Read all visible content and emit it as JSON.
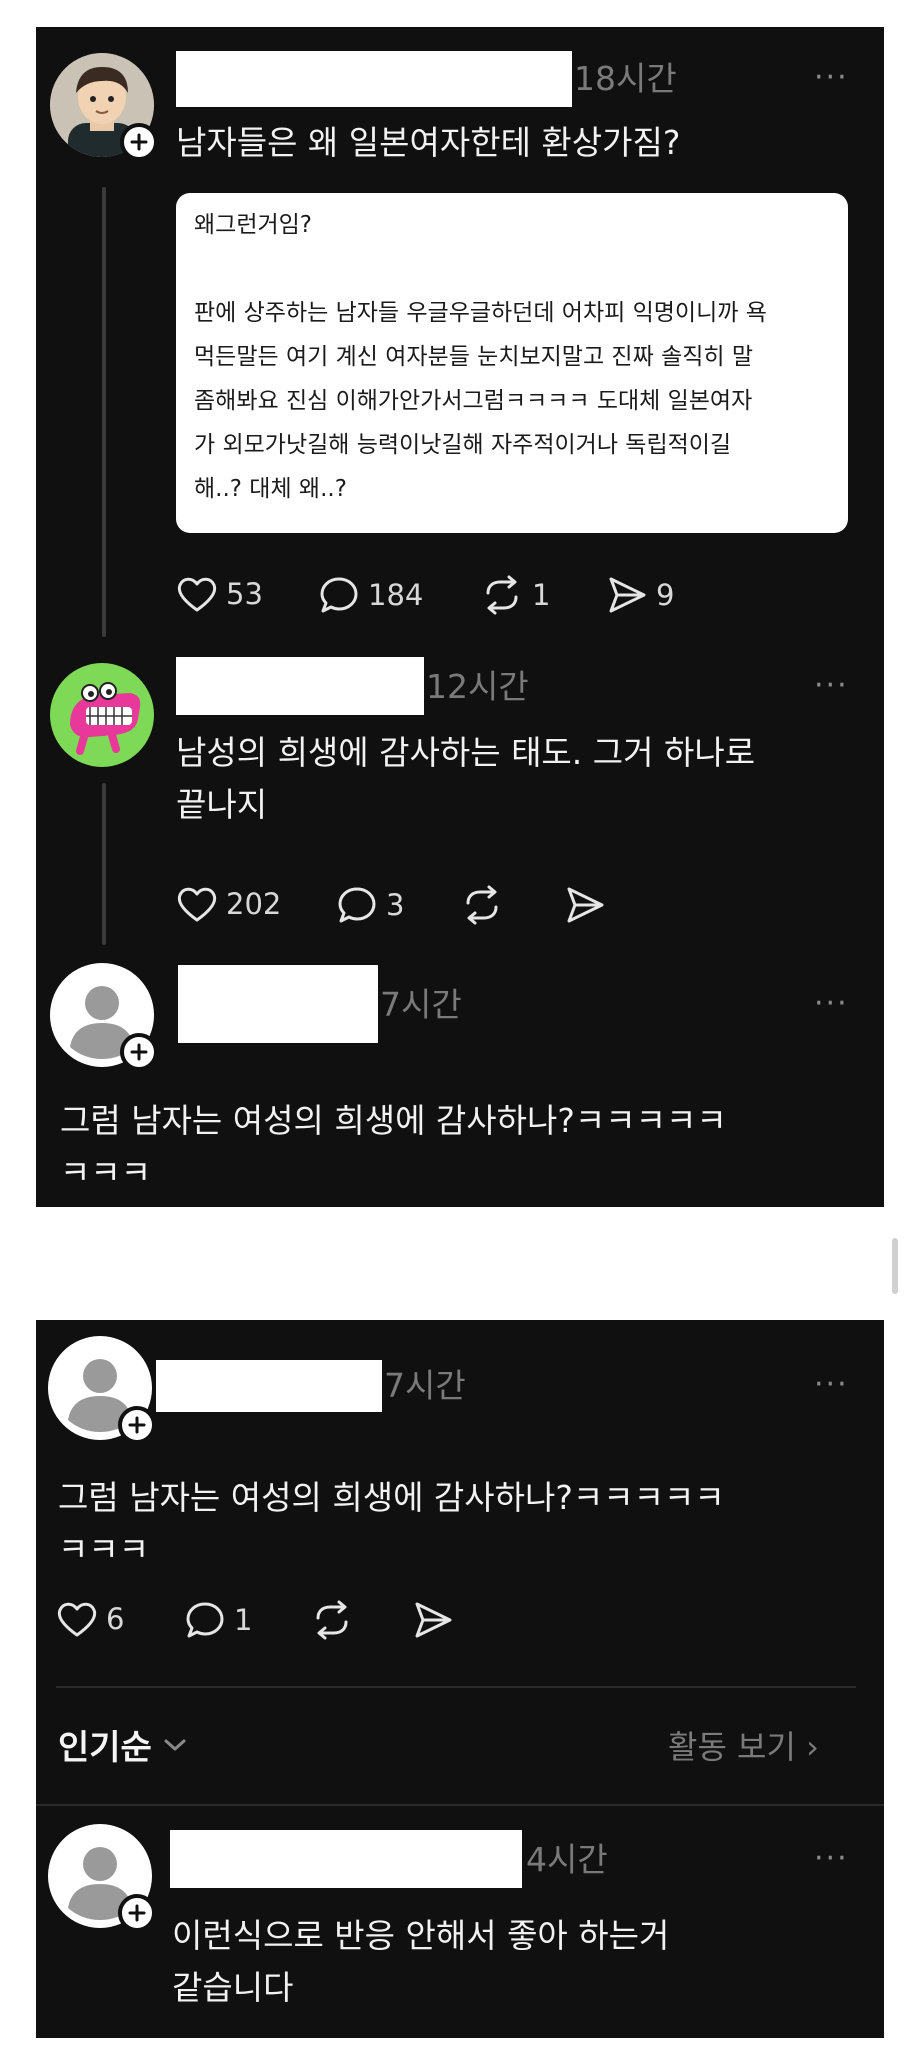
{
  "panel1": {
    "post": {
      "time": "18시간",
      "text": "남자들은 왜 일본여자한테 환상가짐?",
      "quote_lines": [
        "왜그런거임?",
        "",
        "판에 상주하는 남자들 우글우글하던데 어차피 익명이니까 욕",
        "먹든말든 여기 계신 여자분들 눈치보지말고 진짜 솔직히 말",
        "좀해봐요 진심 이해가안가서그럼ㅋㅋㅋㅋ 도대체 일본여자",
        "가 외모가낫길해 능력이낫길해 자주적이거나 독립적이길",
        "해..? 대체 왜..?"
      ],
      "likes": "53",
      "comments": "184",
      "reposts": "1",
      "shares": "9"
    },
    "reply1": {
      "time": "12시간",
      "text_lines": [
        "남성의 희생에 감사하는 태도. 그거 하나로",
        "끝나지"
      ],
      "likes": "202",
      "comments": "3"
    },
    "reply2": {
      "time": "7시간",
      "text_lines": [
        "그럼 남자는 여성의 희생에 감사하나?ㅋㅋㅋㅋㅋ",
        "ㅋㅋㅋ"
      ]
    }
  },
  "panel2": {
    "comment": {
      "time": "7시간",
      "text_lines": [
        "그럼 남자는 여성의 희생에 감사하나?ㅋㅋㅋㅋㅋ",
        "ㅋㅋㅋ"
      ],
      "likes": "6",
      "comments": "1"
    },
    "sort": {
      "label": "인기순",
      "activity": "활동 보기 ›"
    },
    "reply": {
      "time": "4시간",
      "text_lines": [
        "이런식으로 반응 안해서 좋아 하는거",
        "같습니다"
      ]
    }
  },
  "more_label": "···",
  "colors": {
    "background": "#101010",
    "text": "#f2f2f2",
    "muted": "#7a7a7a",
    "avatar_green": "#7ed957",
    "crocodile_pink": "#e8389a"
  }
}
